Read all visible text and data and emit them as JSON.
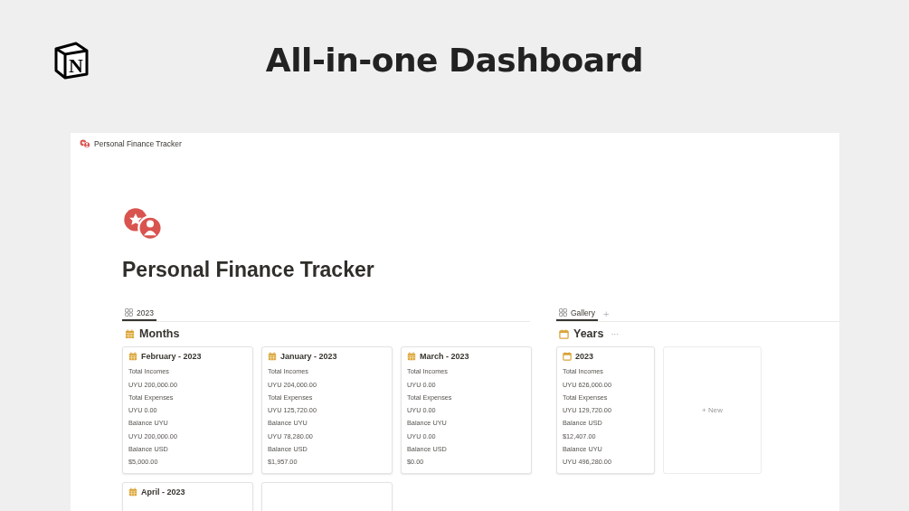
{
  "header": {
    "logo_letter": "N",
    "title": "All-in-one Dashboard"
  },
  "breadcrumb": "Personal Finance Tracker",
  "page_title": "Personal Finance Tracker",
  "left": {
    "tabs": [
      {
        "label": "2023",
        "selected": true
      }
    ],
    "section": "Months",
    "cards": [
      {
        "kind": "filled",
        "title": "February - 2023",
        "props": [
          "Total Incomes",
          "UYU 200,000.00",
          "Total Expenses",
          "UYU 0.00",
          "Balance UYU",
          "UYU 200,000.00",
          "Balance USD",
          "$5,000.00"
        ]
      },
      {
        "kind": "filled",
        "title": "January - 2023",
        "props": [
          "Total Incomes",
          "UYU 204,000.00",
          "Total Expenses",
          "UYU 125,720.00",
          "Balance UYU",
          "UYU 78,280.00",
          "Balance USD",
          "$1,957.00"
        ]
      },
      {
        "kind": "filled",
        "title": "March - 2023",
        "props": [
          "Total Incomes",
          "UYU 0.00",
          "Total Expenses",
          "UYU 0.00",
          "Balance UYU",
          "UYU 0.00",
          "Balance USD",
          "$0.00"
        ]
      },
      {
        "kind": "filled",
        "title": "April - 2023"
      },
      {
        "kind": "blank"
      }
    ]
  },
  "right": {
    "tabs": [
      {
        "label": "Gallery",
        "selected": true
      }
    ],
    "add_tab": "+",
    "section": "Years",
    "more": "···",
    "cards": [
      {
        "kind": "outline",
        "title": "2023",
        "props": [
          "Total Incomes",
          "UYU 626,000.00",
          "Total Expenses",
          "UYU 129,720.00",
          "Balance USD",
          "$12,407.00",
          "Balance UYU",
          "UYU 496,280.00"
        ]
      },
      {
        "kind": "new",
        "label": "+ New"
      }
    ]
  }
}
